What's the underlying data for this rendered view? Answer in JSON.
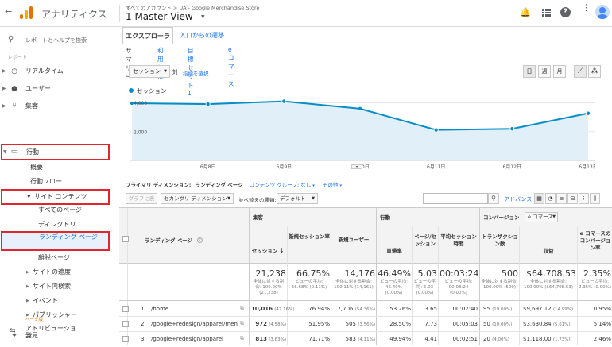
{
  "topbar": {
    "back": "←",
    "app_name": "アナリティクス",
    "breadcrumb": "すべてのアカウント > UA - Google Merchandise Store",
    "view_name": "1 Master View"
  },
  "sidebar": {
    "search_placeholder": "レポートとヘルプを検索",
    "section_label": "レポート",
    "items": [
      {
        "label": "リアルタイム"
      },
      {
        "label": "ユーザー"
      },
      {
        "label": "集客"
      },
      {
        "label": "行動"
      },
      {
        "label": "概要"
      },
      {
        "label": "行動フロー"
      },
      {
        "label": "サイト コンテンツ"
      },
      {
        "label": "すべてのページ"
      },
      {
        "label": "ディレクトリ"
      },
      {
        "label": "ランディング ページ"
      },
      {
        "label": "離脱ページ"
      },
      {
        "label": "サイトの速度"
      },
      {
        "label": "サイト内検索"
      },
      {
        "label": "イベント"
      },
      {
        "label": "パブリッシャー"
      },
      {
        "label": "アトリビューション"
      },
      {
        "label": "ベータ版"
      },
      {
        "label": "発見"
      }
    ]
  },
  "tabs": {
    "explorer": "エクスプローラ",
    "entry_path": "入口からの遷移"
  },
  "subtabs": [
    "サマリー",
    "利用状況",
    "目標セット 1",
    "e コマース"
  ],
  "chart_controls": {
    "metric_select": "セッション",
    "vs": "対",
    "select_metric": "指標を選択",
    "day": "日",
    "week": "週",
    "month": "月"
  },
  "chart_data": {
    "type": "line",
    "series": [
      {
        "name": "セッション",
        "values": [
          3980,
          3920,
          4110,
          3600,
          2120,
          2200,
          3280
        ]
      }
    ],
    "categories": [
      "",
      "6月8日",
      "6月9日",
      "6月10日",
      "6月11日",
      "6月12日",
      "6月13日"
    ],
    "y_ticks": [
      "4,000",
      "2,000"
    ],
    "ylim": [
      0,
      4200
    ],
    "legend": "top-left",
    "color": "#058dc7"
  },
  "dimension_bar": {
    "label": "プライマリ ディメンション:",
    "current": "ランディング ページ",
    "content_group": "コンテンツ グループ: なし",
    "other": "その他"
  },
  "table_controls": {
    "plot_rows": "グラフに表示",
    "secondary_dim": "セカンダリ ディメンション",
    "sort_type_label": "並べ替えの種類:",
    "sort_value": "デフォルト",
    "advanced": "アドバンス"
  },
  "table": {
    "group_acq": "集客",
    "group_beh": "行動",
    "group_conv": "コンバージョン",
    "conv_select": "e コマース",
    "col_page": "ランディング ページ",
    "columns": [
      "セッション",
      "新規セッション率",
      "新規ユーザー",
      "直帰率",
      "ページ/セッション",
      "平均セッション時間",
      "トランザクション数",
      "収益",
      "e コマースのコンバージョン率"
    ],
    "totals": {
      "values": [
        "21,238",
        "66.75%",
        "14,176",
        "46.49%",
        "5.03",
        "00:03:24",
        "500",
        "$64,708.53",
        "2.35%"
      ],
      "subs": [
        "全体に対する割合: 100.00% (21,238)",
        "ビューの平均: 66.68% (0.11%)",
        "全体に対する割合: 100.11% (14,161)",
        "ビューの平均: 46.49% (0.00%)",
        "ビューの平均: 5.03 (0.00%)",
        "ビューの平均: 00:03:24 (0.00%)",
        "全体に対する割合: 100.00% (500)",
        "全体に対する割合: 100.00% ($64,708.53)",
        "ビューの平均: 2.35% (0.00%)"
      ]
    },
    "rows": [
      {
        "num": "1.",
        "page": "/home",
        "sessions": "10,016",
        "sessions_pct": "(47.16%)",
        "new_rate": "76.94%",
        "new_users": "7,706",
        "new_users_pct": "(54.36%)",
        "bounce": "53.26%",
        "pps": "3.65",
        "dur": "00:02:40",
        "tx": "95",
        "tx_pct": "(19.00%)",
        "rev": "$9,697.12",
        "rev_pct": "(14.99%)",
        "conv": "0.95%"
      },
      {
        "num": "2.",
        "page": "/google+redesign/apparel/mens",
        "sessions": "972",
        "sessions_pct": "(4.58%)",
        "new_rate": "51.95%",
        "new_users": "505",
        "new_users_pct": "(3.56%)",
        "bounce": "28.50%",
        "pps": "7.73",
        "dur": "00:05:03",
        "tx": "50",
        "tx_pct": "(10.00%)",
        "rev": "$3,630.84",
        "rev_pct": "(5.61%)",
        "conv": "5.14%"
      },
      {
        "num": "3.",
        "page": "/google+redesign/apparel",
        "sessions": "813",
        "sessions_pct": "(3.83%)",
        "new_rate": "71.71%",
        "new_users": "583",
        "new_users_pct": "(4.11%)",
        "bounce": "49.94%",
        "pps": "4.41",
        "dur": "00:02:51",
        "tx": "20",
        "tx_pct": "(4.00%)",
        "rev": "$1,118.00",
        "rev_pct": "(1.73%)",
        "conv": "2.46%"
      }
    ]
  }
}
